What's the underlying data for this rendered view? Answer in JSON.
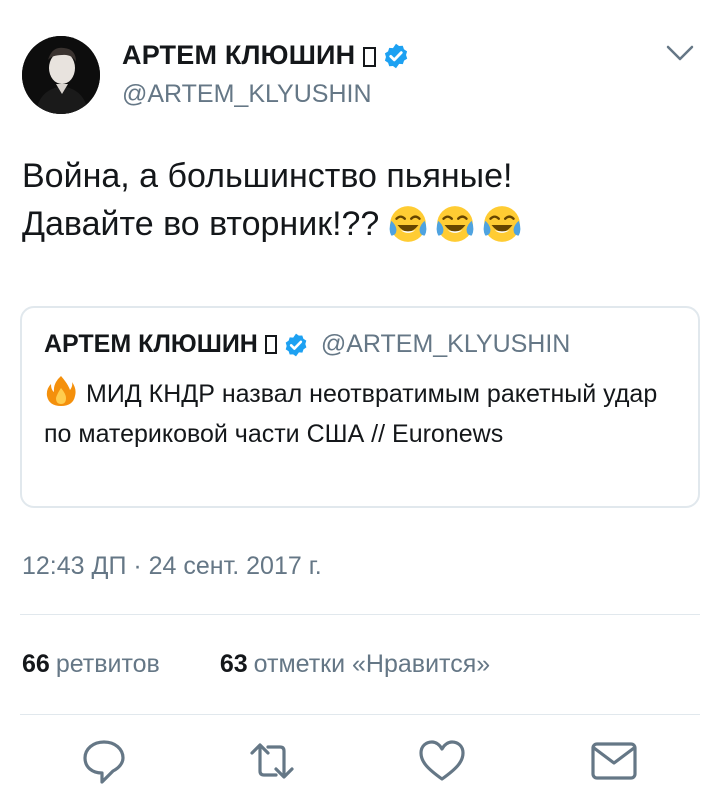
{
  "author": {
    "name": "АРТЕМ КЛЮШИН",
    "handle": "@ARTEM_KLYUSHIN"
  },
  "tweet": {
    "line1": "Война, а большинство пьяные!",
    "line2": "Давайте во вторник!??",
    "emojis": [
      "face-with-tears-of-joy-icon",
      "face-with-tears-of-joy-icon",
      "face-with-tears-of-joy-icon"
    ]
  },
  "quoted": {
    "name": "АРТЕМ КЛЮШИН",
    "handle": "@ARTEM_KLYUSHIN",
    "text": "МИД КНДР назвал неотвратимым ракетный удар по материковой части США // Euronews",
    "emoji": "fire-icon"
  },
  "timestamp": "12:43 ДП · 24 сент. 2017 г.",
  "stats": {
    "retweets_count": "66",
    "retweets_label": "ретвитов",
    "likes_count": "63",
    "likes_label": "отметки «Нравится»"
  },
  "actions": [
    "reply-icon",
    "retweet-icon",
    "like-icon",
    "direct-message-icon"
  ],
  "colors": {
    "verified_blue": "#1da1f2",
    "secondary_text": "#657786",
    "divider": "#e1e8ed"
  }
}
